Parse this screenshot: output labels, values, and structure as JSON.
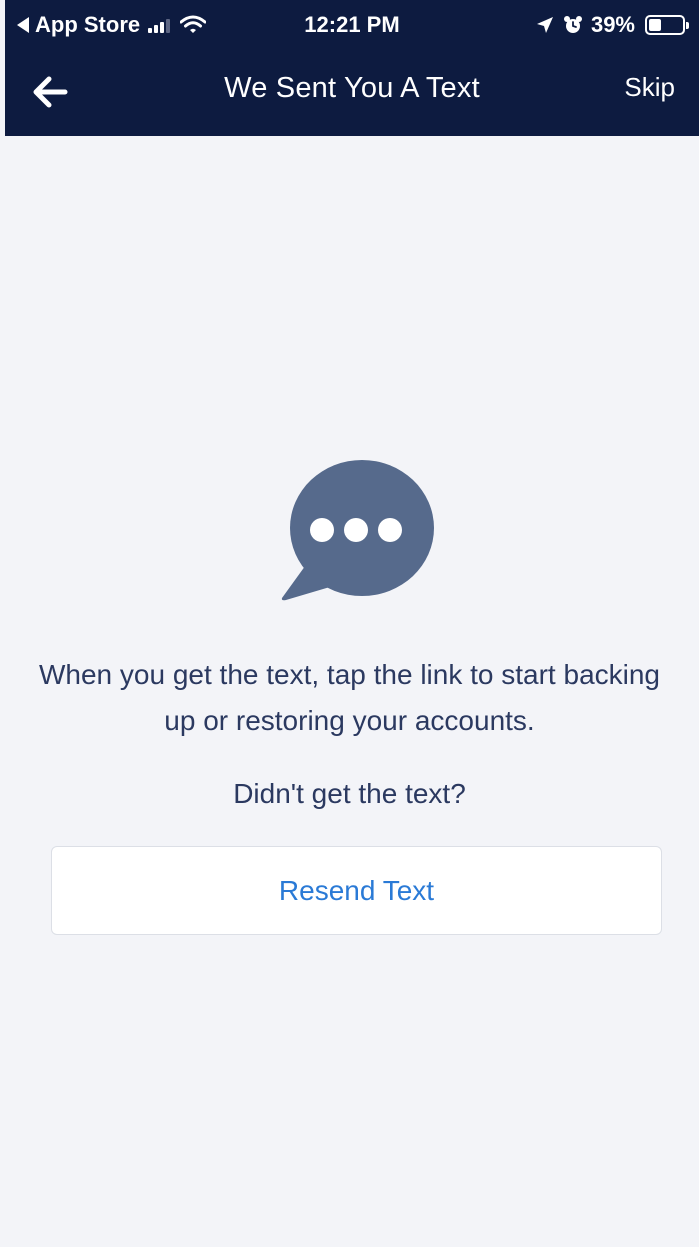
{
  "status_bar": {
    "back_app_label": "App Store",
    "time": "12:21 PM",
    "battery_text": "39%",
    "battery_level": 0.39
  },
  "nav": {
    "back_icon": "arrow-left-icon",
    "title": "We Sent You A Text",
    "skip_label": "Skip"
  },
  "content": {
    "icon": "chat-bubble-icon",
    "message": "When you get the text, tap the link to start backing up or restoring your accounts.",
    "question": "Didn't get the text?",
    "resend_label": "Resend Text"
  },
  "colors": {
    "header_bg": "#0d1b40",
    "page_bg": "#f3f4f8",
    "text": "#2b3960",
    "link": "#2a7ad6",
    "bubble": "#566a8c"
  }
}
